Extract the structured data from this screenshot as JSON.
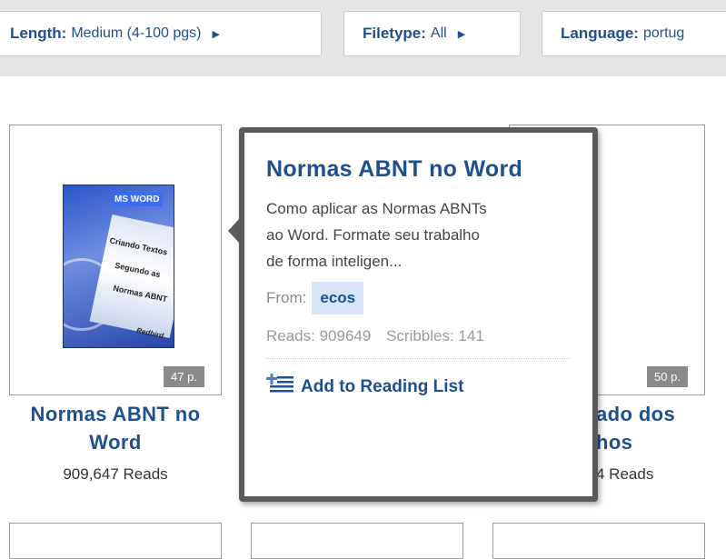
{
  "filters": [
    {
      "label": "Length:",
      "value": "Medium (4-100 pgs)"
    },
    {
      "label": "Filetype:",
      "value": "All"
    },
    {
      "label": "Language:",
      "value": "portug"
    }
  ],
  "cards": [
    {
      "title_line1": "Normas ABNT no",
      "title_line2": "Word",
      "reads": "909,647 Reads",
      "pages": "47 p.",
      "cover_text": {
        "tag": "MS WORD",
        "line1": "Criando Textos",
        "line2": "Segundo as",
        "line3": "Normas ABNT",
        "publisher": "Redbird"
      }
    },
    {
      "title_line1": "ado dos",
      "title_line2": "hos",
      "reads": "4 Reads",
      "pages": "50 p."
    }
  ],
  "popover": {
    "title": "Normas ABNT no Word",
    "desc_line1": "Como aplicar as Normas ABNTs",
    "desc_line2": "ao Word. Formate seu trabalho",
    "desc_line3": "de forma inteligen...",
    "from_label": "From:",
    "author": "ecos",
    "reads": "Reads: 909649",
    "scribbles": "Scribbles: 141",
    "add_label": "Add to Reading List"
  },
  "colors": {
    "link": "#1e4f8f",
    "popover_border": "#5b5b5b",
    "author_bg": "#d6e4f5"
  }
}
